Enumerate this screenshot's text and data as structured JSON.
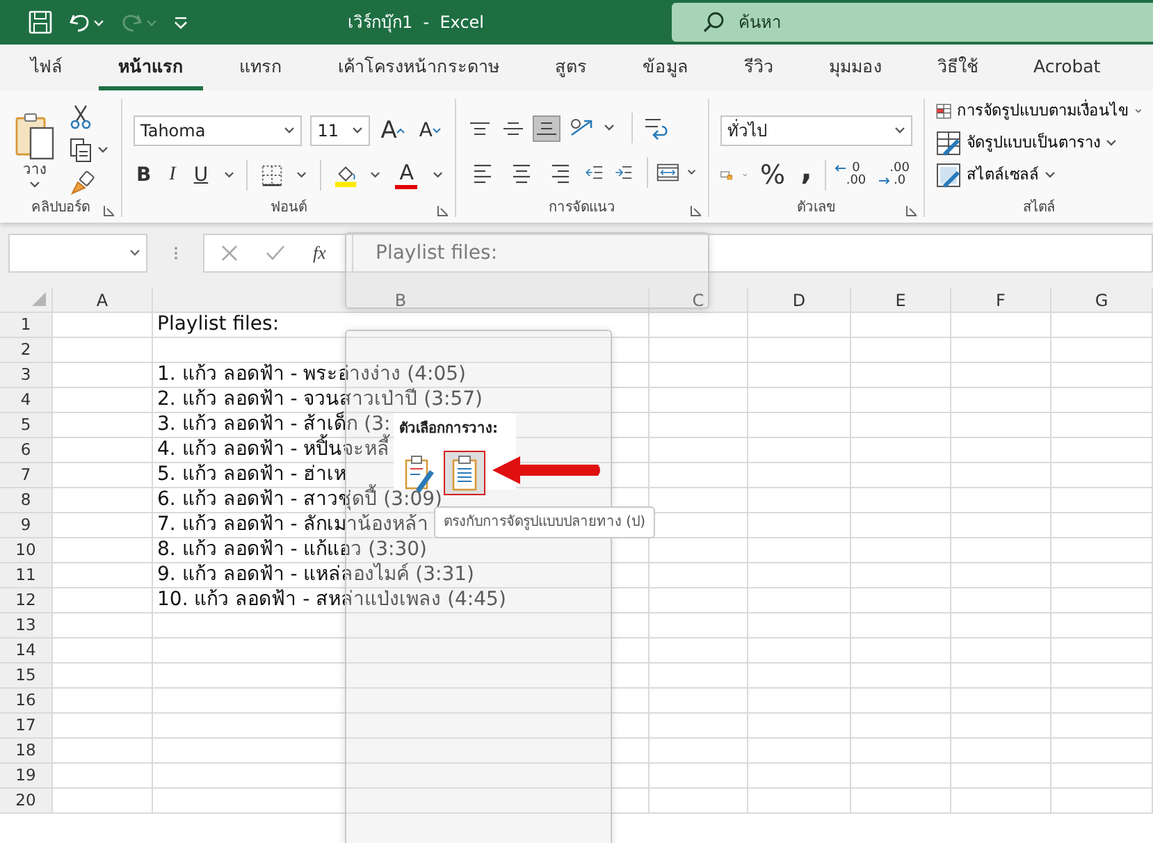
{
  "title_bar": {
    "title": "เวิร์กบุ๊ก1  -  Excel",
    "search_placeholder": "ค้นหา",
    "quick_access": [
      {
        "kind": "save",
        "disabled": false
      },
      {
        "kind": "undo",
        "disabled": false
      },
      {
        "kind": "redo",
        "disabled": true
      },
      {
        "kind": "customize",
        "disabled": false
      }
    ]
  },
  "tabs": [
    {
      "label": "ไฟล์",
      "selected": false
    },
    {
      "label": "หน้าแรก",
      "selected": true
    },
    {
      "label": "แทรก",
      "selected": false
    },
    {
      "label": "เค้าโครงหน้ากระดาษ",
      "selected": false
    },
    {
      "label": "สูตร",
      "selected": false
    },
    {
      "label": "ข้อมูล",
      "selected": false
    },
    {
      "label": "รีวิว",
      "selected": false
    },
    {
      "label": "มุมมอง",
      "selected": false
    },
    {
      "label": "วิธีใช้",
      "selected": false
    },
    {
      "label": "Acrobat",
      "selected": false
    }
  ],
  "ribbon": {
    "clipboard": {
      "paste_label": "วาง",
      "group_label": "คลิปบอร์ด"
    },
    "font": {
      "font_name": "Tahoma",
      "font_size": "11",
      "grow_label": "A",
      "shrink_label": "A",
      "style_buttons": [
        "B",
        "I",
        "U"
      ],
      "font_color_label": "A",
      "group_label": "ฟอนต์"
    },
    "alignment": {
      "vertical": [
        {
          "kind": "top",
          "selected": false
        },
        {
          "kind": "middle",
          "selected": false
        },
        {
          "kind": "bottom",
          "selected": true
        }
      ],
      "horizontal": [
        {
          "kind": "left",
          "selected": false
        },
        {
          "kind": "center",
          "selected": false
        },
        {
          "kind": "right",
          "selected": false
        }
      ],
      "group_label": "การจัดแนว"
    },
    "number": {
      "format": "ทั่วไป",
      "percent_label": "%",
      "comma_label": ",",
      "decimals": [
        {
          "kind": "increase",
          "upper": "0",
          "lower": ".00"
        },
        {
          "kind": "decrease",
          "upper": ".00",
          "lower": ".0"
        }
      ],
      "group_label": "ตัวเลข"
    },
    "styles": {
      "items": [
        "การจัดรูปแบบตามเงื่อนไข",
        "จัดรูปแบบเป็นตาราง",
        "สไตล์เซลล์"
      ],
      "group_label": "สไตล์"
    }
  },
  "formula_bar": {
    "function_label": "fx",
    "formula": "Playlist files:"
  },
  "sheet": {
    "columns": [
      "A",
      "B",
      "C",
      "D",
      "E",
      "F",
      "G"
    ],
    "rows": [
      {
        "number": "1",
        "text": "Playlist files:"
      },
      {
        "number": "2"
      },
      {
        "number": "3",
        "text": "1. แก้ว ลอดฟ้า - พระอ่างง่าง (4:05)"
      },
      {
        "number": "4",
        "text": "2. แก้ว ลอดฟ้า - จวนสาวเป่าปี (3:57)"
      },
      {
        "number": "5",
        "text": "3. แก้ว ลอดฟ้า - ส้าเด็ก (3:"
      },
      {
        "number": "6",
        "text": "4. แก้ว ลอดฟ้า - หปิ้นจะหลี้"
      },
      {
        "number": "7",
        "text": "5. แก้ว ลอดฟ้า - ฮ่าเห"
      },
      {
        "number": "8",
        "text": "6. แก้ว ลอดฟ้า - สาวชุ่ดปี้ (3:09)"
      },
      {
        "number": "9",
        "text": "7. แก้ว ลอดฟ้า - ลักเมาน้องหล้า"
      },
      {
        "number": "10",
        "text": "8. แก้ว ลอดฟ้า - แก้แอว (3:30)"
      },
      {
        "number": "11",
        "text": "9. แก้ว ลอดฟ้า - แหล่ลองไมค์ (3:31)"
      },
      {
        "number": "12",
        "text": "10. แก้ว ลอดฟ้า - สหล่าแป่งเพลง (4:45)"
      },
      {
        "number": "13"
      },
      {
        "number": "14"
      },
      {
        "number": "15"
      },
      {
        "number": "16"
      },
      {
        "number": "17"
      },
      {
        "number": "18"
      },
      {
        "number": "19"
      },
      {
        "number": "20"
      }
    ]
  },
  "paste_options": {
    "title": "ตัวเลือกการวาง:",
    "options": [
      {
        "kind": "keep-source",
        "selected": false
      },
      {
        "kind": "match-destination",
        "selected": true
      }
    ],
    "tooltip": "ตรงกับการจัดรูปแบบปลายทาง (ป)"
  }
}
